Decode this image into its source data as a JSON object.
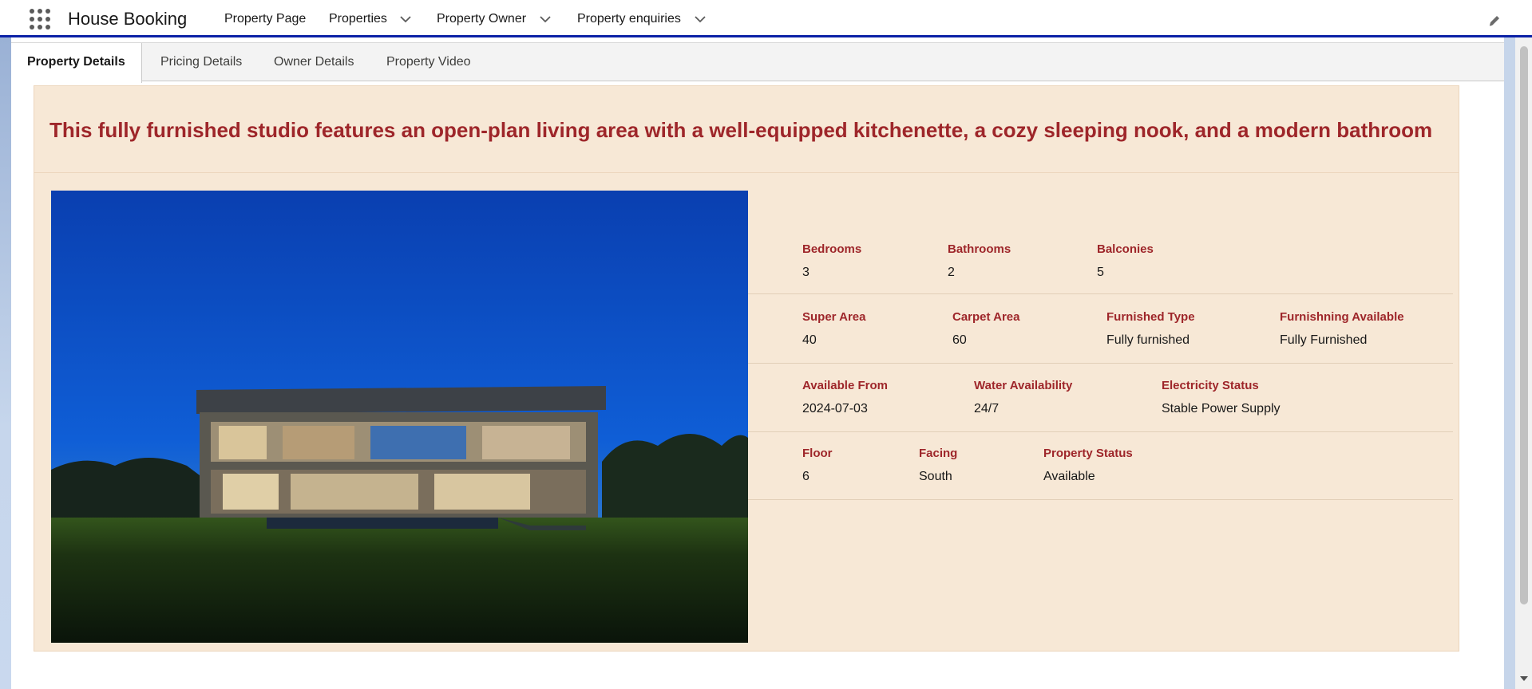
{
  "header": {
    "app_name": "House Booking",
    "nav": [
      {
        "label": "Property Page"
      },
      {
        "label": "Properties"
      },
      {
        "label": "Property Owner"
      },
      {
        "label": "Property enquiries"
      }
    ],
    "brand_color": "#0b21a6"
  },
  "tabs": [
    {
      "label": "Property Details"
    },
    {
      "label": "Pricing Details"
    },
    {
      "label": "Owner Details"
    },
    {
      "label": "Property Video"
    }
  ],
  "property": {
    "headline": "This fully furnished studio features an open-plan living area with a well-equipped kitchenette, a cozy sleeping nook, and a modern bathroom",
    "accent_color": "#9e262a",
    "card_color": "#f7e8d6",
    "rows": [
      [
        {
          "label": "Bedrooms",
          "value": "3"
        },
        {
          "label": "Bathrooms",
          "value": "2"
        },
        {
          "label": "Balconies",
          "value": "5"
        }
      ],
      [
        {
          "label": "Super Area",
          "value": "40"
        },
        {
          "label": "Carpet Area",
          "value": "60"
        },
        {
          "label": "Furnished Type",
          "value": "Fully furnished"
        },
        {
          "label": "Furnishning Available",
          "value": "Fully Furnished"
        }
      ],
      [
        {
          "label": "Available From",
          "value": "2024-07-03"
        },
        {
          "label": "Water Availability",
          "value": "24/7"
        },
        {
          "label": "Electricity Status",
          "value": "Stable Power Supply"
        }
      ],
      [
        {
          "label": "Floor",
          "value": "6"
        },
        {
          "label": "Facing",
          "value": "South"
        },
        {
          "label": "Property Status",
          "value": "Available"
        }
      ]
    ]
  }
}
